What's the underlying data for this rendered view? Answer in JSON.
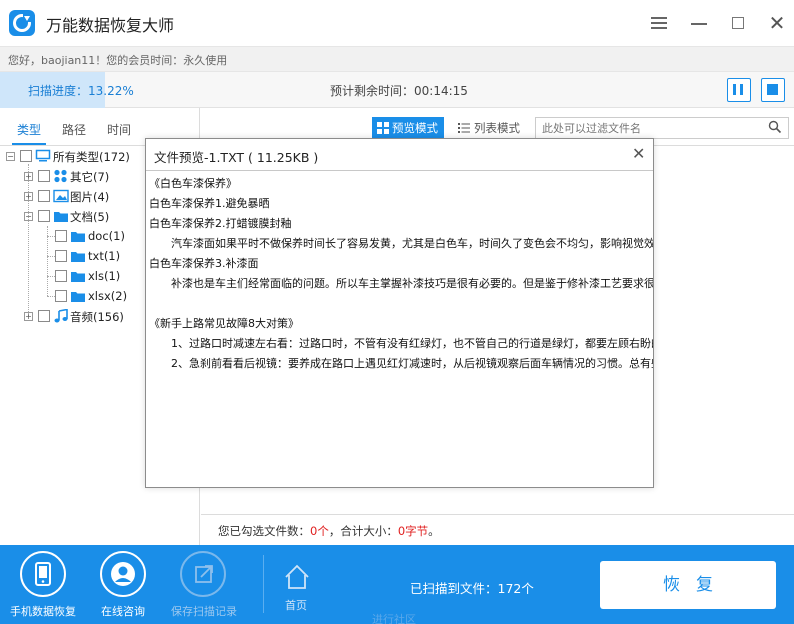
{
  "app": {
    "title": "万能数据恢复大师",
    "greeting": "您好，baojian11！您的会员时间：永久使用"
  },
  "scan": {
    "progress_label": "扫描进度：13.22%",
    "progress_percent": 13.22,
    "remaining": "预计剩余时间：00:14:15"
  },
  "tabs": [
    "类型",
    "路径",
    "时间"
  ],
  "tree": {
    "root": "所有类型(172)",
    "other": "其它(7)",
    "images": "图片(4)",
    "docs": "文档(5)",
    "doc": "doc(1)",
    "txt": "txt(1)",
    "xls": "xls(1)",
    "xlsx": "xlsx(2)",
    "audio": "音频(156)"
  },
  "toolbar": {
    "preview_mode": "预览模式",
    "list_mode": "列表模式",
    "filter_placeholder": "此处可以过滤文件名"
  },
  "dialog": {
    "title": "文件预览-1.TXT ( 11.25KB )",
    "lines": [
      "《白色车漆保养》",
      "白色车漆保养1.避免暴晒",
      "白色车漆保养2.打蜡镀膜封釉",
      "　　汽车漆面如果平时不做保养时间长了容易发黄，尤其是白色车，时间久了变色会不均匀，影响视觉效",
      "白色车漆保养3.补漆面",
      "　　补漆也是车主们经常面临的问题。所以车主掌握补漆技巧是很有必要的。但是鉴于修补漆工艺要求很",
      "",
      "《新手上路常见故障8大对策》",
      "　　1、过路口时减速左右看：过路口时，不管有没有红绿灯，也不管自己的行道是绿灯，都要左顾右盼的",
      "　　2、急刹前看看后视镜：要养成在路口上遇见红灯减速时，从后视镜观察后面车辆情况的习惯。总有些"
    ]
  },
  "selection": {
    "prefix": "您已勾选文件数：",
    "count": "0个",
    "middle": "，合计大小：",
    "size": "0字节",
    "suffix": "。"
  },
  "bottom": {
    "phone_recovery": "手机数据恢复",
    "online_consult": "在线咨询",
    "save_record": "保存扫描记录",
    "home": "首页",
    "scanned_files": "已扫描到文件：172个",
    "recover": "恢复",
    "community": "进行社区"
  },
  "colors": {
    "accent": "#1a8ee8",
    "progress_fill": "#cfe6fa",
    "red": "#e02020"
  }
}
